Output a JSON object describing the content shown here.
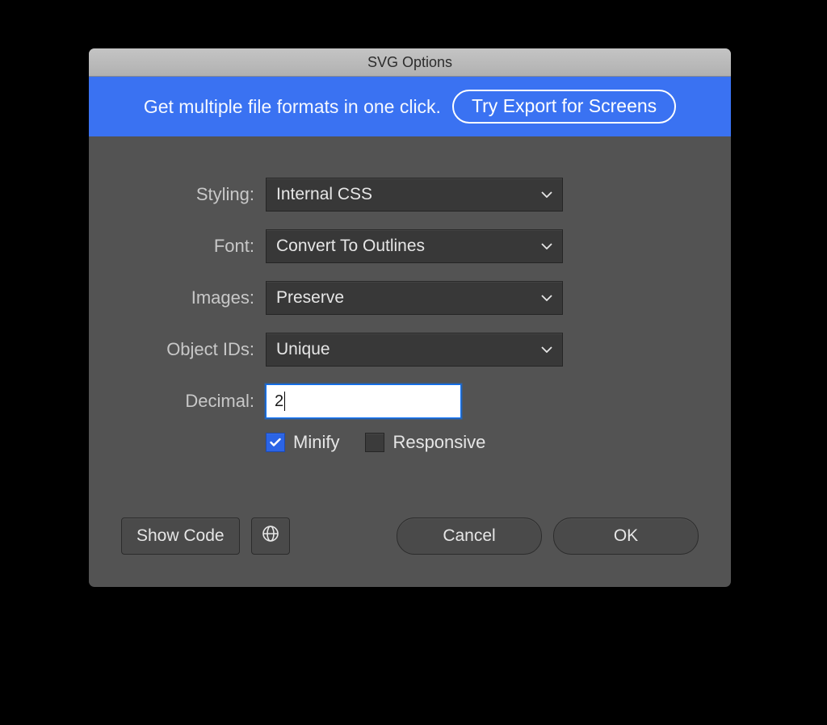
{
  "dialog": {
    "title": "SVG Options"
  },
  "banner": {
    "text": "Get multiple file formats in one click.",
    "try_label": "Try Export for Screens"
  },
  "form": {
    "styling_label": "Styling:",
    "styling_value": "Internal CSS",
    "font_label": "Font:",
    "font_value": "Convert To Outlines",
    "images_label": "Images:",
    "images_value": "Preserve",
    "objectids_label": "Object IDs:",
    "objectids_value": "Unique",
    "decimal_label": "Decimal:",
    "decimal_value": "2",
    "minify_label": "Minify",
    "minify_checked": true,
    "responsive_label": "Responsive",
    "responsive_checked": false
  },
  "footer": {
    "show_code": "Show Code",
    "cancel": "Cancel",
    "ok": "OK"
  }
}
